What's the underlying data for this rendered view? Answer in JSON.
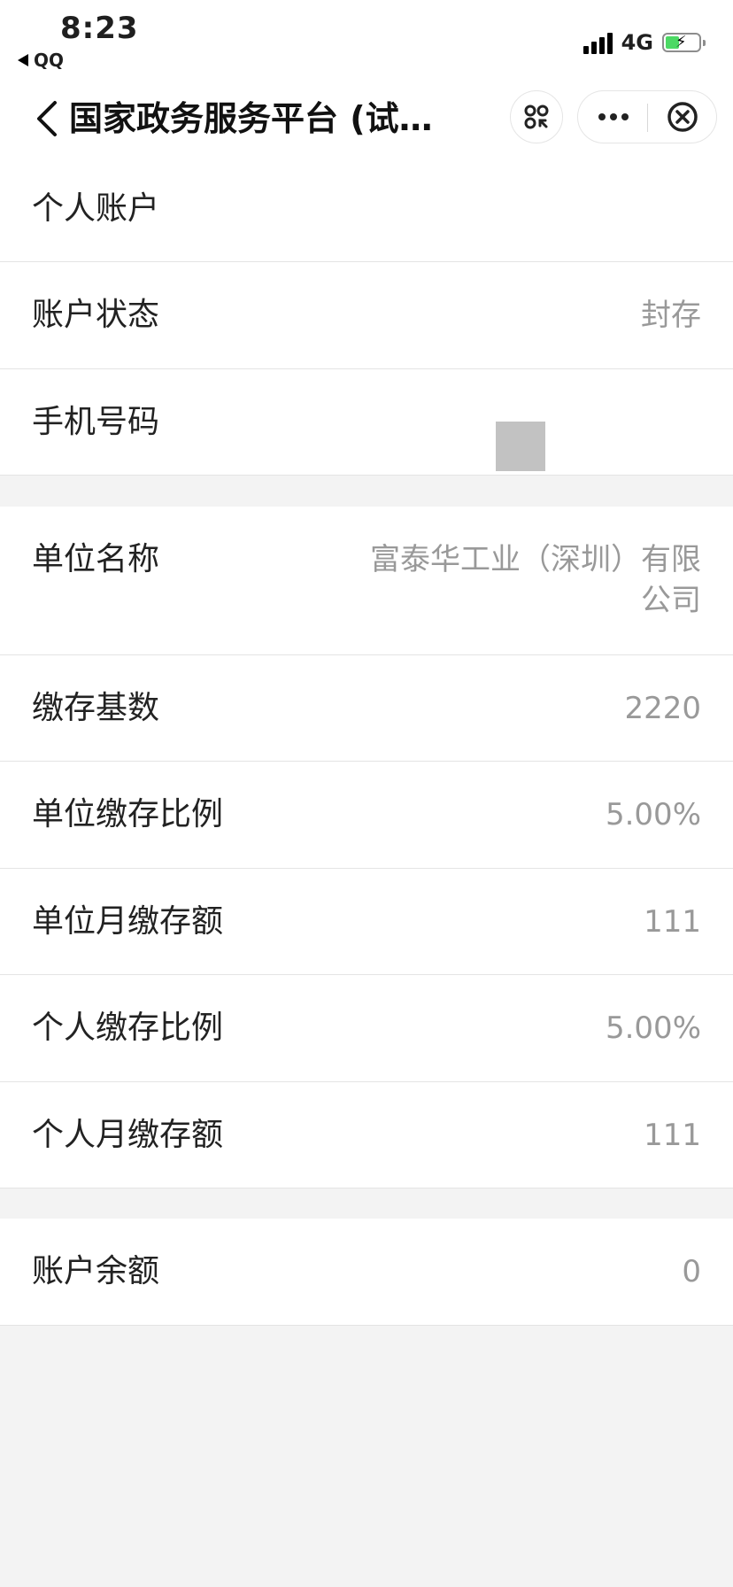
{
  "status_bar": {
    "time": "8:23",
    "back_app": "QQ",
    "network": "4G",
    "battery_level": 0.45,
    "battery_color": "#4cd964"
  },
  "nav": {
    "title": "国家政务服务平台 (试…",
    "icons": [
      "back-chevron-icon",
      "scan-icon",
      "more-icon",
      "close-circle-icon"
    ]
  },
  "section1": {
    "header": "个人账户",
    "rows": [
      {
        "label": "账户状态",
        "value": "封存"
      },
      {
        "label": "手机号码",
        "value": ""
      }
    ]
  },
  "section2": {
    "rows": [
      {
        "label": "单位名称",
        "value_line1": "富泰华工业（深圳）有限",
        "value_line2": "公司"
      },
      {
        "label": "缴存基数",
        "value": "2220"
      },
      {
        "label": "单位缴存比例",
        "value": "5.00%"
      },
      {
        "label": "单位月缴存额",
        "value": "111"
      },
      {
        "label": "个人缴存比例",
        "value": "5.00%"
      },
      {
        "label": "个人月缴存额",
        "value": "111"
      }
    ]
  },
  "section3": {
    "rows": [
      {
        "label": "账户余额",
        "value": "0"
      }
    ]
  },
  "colors": {
    "background": "#f3f3f3",
    "row_background": "#ffffff",
    "label_text": "#222222",
    "value_text": "#999999",
    "divider": "#e4e4e4",
    "masked_block": "#c2c2c2"
  }
}
